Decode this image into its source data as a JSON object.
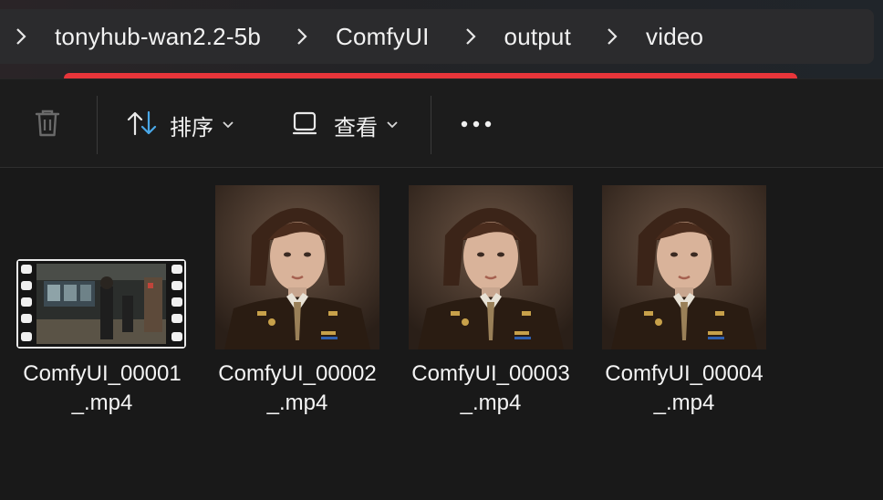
{
  "breadcrumb": {
    "items": [
      "tonyhub-wan2.2-5b",
      "ComfyUI",
      "output",
      "video"
    ]
  },
  "toolbar": {
    "delete_icon": "trash-icon",
    "sort_label": "排序",
    "view_label": "查看",
    "more_icon": "more-icon"
  },
  "files": [
    {
      "name_line1": "ComfyUI_00001",
      "name_line2": "_.mp4",
      "thumb": "video-film-strip"
    },
    {
      "name_line1": "ComfyUI_00002",
      "name_line2": "_.mp4",
      "thumb": "portrait"
    },
    {
      "name_line1": "ComfyUI_00003",
      "name_line2": "_.mp4",
      "thumb": "portrait"
    },
    {
      "name_line1": "ComfyUI_00004",
      "name_line2": "_.mp4",
      "thumb": "portrait"
    }
  ],
  "colors": {
    "accent_underline": "#e8353a",
    "background": "#191919"
  }
}
